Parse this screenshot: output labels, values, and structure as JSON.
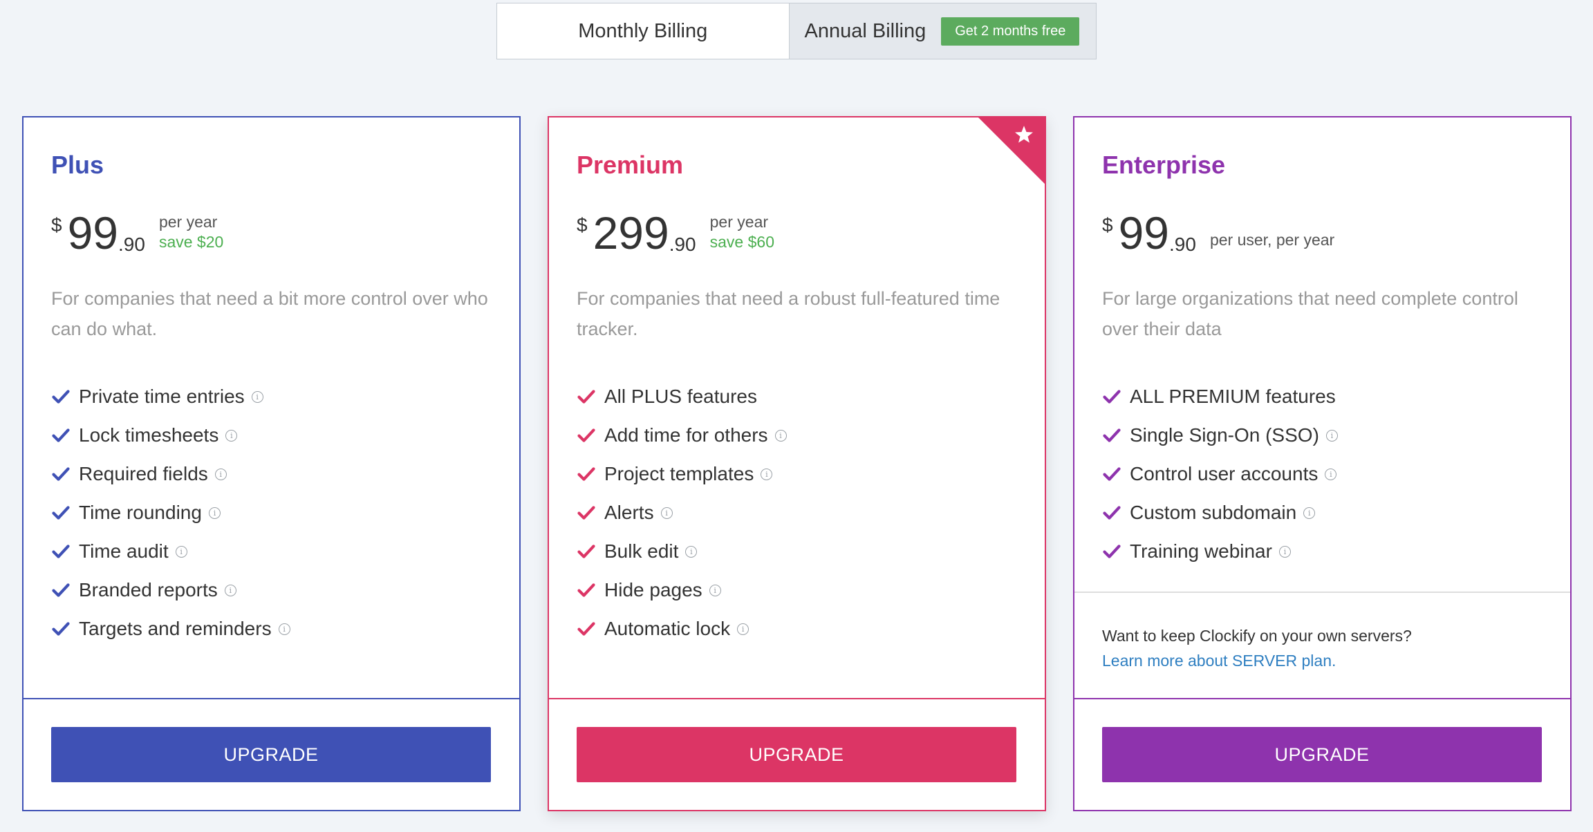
{
  "billing_toggle": {
    "monthly_label": "Monthly Billing",
    "annual_label": "Annual Billing",
    "annual_badge": "Get 2 months free"
  },
  "colors": {
    "plus": "#3f51b5",
    "premium": "#dc3565",
    "enterprise": "#8e33ad",
    "save_green": "#4caf50",
    "badge_green": "#5cab5e",
    "link_blue": "#2f7fc1"
  },
  "plans": {
    "plus": {
      "name": "Plus",
      "currency": "$",
      "amount": "99",
      "cents": ".90",
      "period": "per year",
      "save": "save $20",
      "description": "For companies that need a bit more control over who can do what.",
      "features": [
        "Private time entries",
        "Lock timesheets",
        "Required fields",
        "Time rounding",
        "Time audit",
        "Branded reports",
        "Targets and reminders"
      ],
      "button": "UPGRADE"
    },
    "premium": {
      "name": "Premium",
      "currency": "$",
      "amount": "299",
      "cents": ".90",
      "period": "per year",
      "save": "save $60",
      "description": "For companies that need a robust full-featured time tracker.",
      "features": [
        "All PLUS features",
        "Add time for others",
        "Project templates",
        "Alerts",
        "Bulk edit",
        "Hide pages",
        "Automatic lock"
      ],
      "button": "UPGRADE",
      "corner_icon": "star-icon"
    },
    "enterprise": {
      "name": "Enterprise",
      "currency": "$",
      "amount": "99",
      "cents": ".90",
      "period": "per user, per year",
      "description": "For large organizations that need complete control over their data",
      "features": [
        "ALL PREMIUM features",
        "Single Sign-On (SSO)",
        "Control user accounts",
        "Custom subdomain",
        "Training webinar"
      ],
      "server_text": "Want to keep Clockify on your own servers?",
      "server_link": "Learn more about SERVER plan.",
      "button": "UPGRADE"
    }
  },
  "info_flags": {
    "plus": [
      true,
      true,
      true,
      true,
      true,
      true,
      true
    ],
    "premium": [
      false,
      true,
      true,
      true,
      true,
      true,
      true
    ],
    "enterprise": [
      false,
      true,
      true,
      true,
      true
    ]
  }
}
